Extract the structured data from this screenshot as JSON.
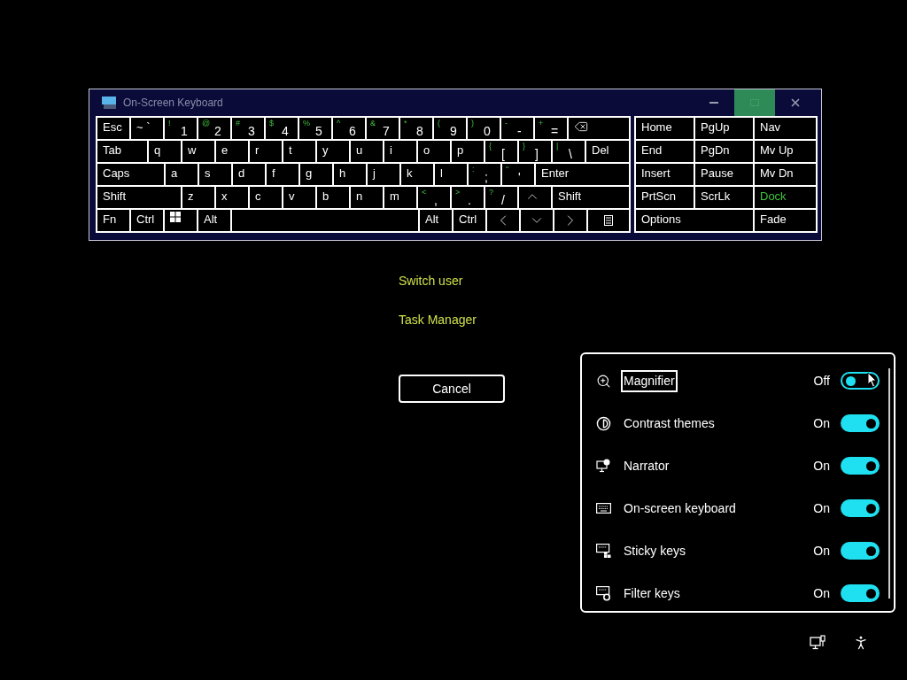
{
  "keyboard_window": {
    "title": "On-Screen Keyboard",
    "controls": [
      {
        "kind": "minimize",
        "hovered": false
      },
      {
        "kind": "maximize",
        "hovered": true
      },
      {
        "kind": "close",
        "hovered": false
      }
    ],
    "rows": [
      [
        {
          "label": "Esc"
        },
        {
          "label": "~ `"
        },
        {
          "label": "1",
          "shift": "!"
        },
        {
          "label": "2",
          "shift": "@"
        },
        {
          "label": "3",
          "shift": "#"
        },
        {
          "label": "4",
          "shift": "$"
        },
        {
          "label": "5",
          "shift": "%"
        },
        {
          "label": "6",
          "shift": "^"
        },
        {
          "label": "7",
          "shift": "&"
        },
        {
          "label": "8",
          "shift": "*"
        },
        {
          "label": "9",
          "shift": "("
        },
        {
          "label": "0",
          "shift": ")"
        },
        {
          "label": "-",
          "shift": "-"
        },
        {
          "label": "=",
          "shift": "+"
        },
        {
          "kind": "backspace"
        }
      ],
      [
        {
          "label": "Tab"
        },
        {
          "label": "q"
        },
        {
          "label": "w"
        },
        {
          "label": "e"
        },
        {
          "label": "r"
        },
        {
          "label": "t"
        },
        {
          "label": "y"
        },
        {
          "label": "u"
        },
        {
          "label": "i"
        },
        {
          "label": "o"
        },
        {
          "label": "p"
        },
        {
          "label": "[",
          "shift": "{"
        },
        {
          "label": "]",
          "shift": "}"
        },
        {
          "label": "\\",
          "shift": "|"
        },
        {
          "label": "Del"
        }
      ],
      [
        {
          "label": "Caps"
        },
        {
          "label": "a"
        },
        {
          "label": "s"
        },
        {
          "label": "d"
        },
        {
          "label": "f"
        },
        {
          "label": "g"
        },
        {
          "label": "h"
        },
        {
          "label": "j"
        },
        {
          "label": "k"
        },
        {
          "label": "l"
        },
        {
          "label": ";",
          "shift": ":"
        },
        {
          "label": "'",
          "shift": "\""
        },
        {
          "label": "Enter"
        }
      ],
      [
        {
          "label": "Shift"
        },
        {
          "label": "z"
        },
        {
          "label": "x"
        },
        {
          "label": "c"
        },
        {
          "label": "v"
        },
        {
          "label": "b"
        },
        {
          "label": "n"
        },
        {
          "label": "m"
        },
        {
          "label": ",",
          "shift": "<"
        },
        {
          "label": ".",
          "shift": ">"
        },
        {
          "label": "/",
          "shift": "?"
        },
        {
          "kind": "up"
        },
        {
          "label": "Shift"
        }
      ],
      [
        {
          "label": "Fn"
        },
        {
          "label": "Ctrl"
        },
        {
          "kind": "windows"
        },
        {
          "label": "Alt"
        },
        {
          "kind": "space"
        },
        {
          "label": "Alt"
        },
        {
          "label": "Ctrl"
        },
        {
          "kind": "left"
        },
        {
          "kind": "down"
        },
        {
          "kind": "right"
        },
        {
          "kind": "menu"
        }
      ]
    ],
    "side_rows": [
      [
        {
          "label": "Home",
          "on": false
        },
        {
          "label": "PgUp",
          "on": false
        },
        {
          "label": "Nav",
          "on": false
        }
      ],
      [
        {
          "label": "End",
          "on": false
        },
        {
          "label": "PgDn",
          "on": false
        },
        {
          "label": "Mv Up",
          "on": false
        }
      ],
      [
        {
          "label": "Insert",
          "on": false
        },
        {
          "label": "Pause",
          "on": false
        },
        {
          "label": "Mv Dn",
          "on": false
        }
      ],
      [
        {
          "label": "PrtScn",
          "on": false
        },
        {
          "label": "ScrLk",
          "on": false
        },
        {
          "label": "Dock",
          "on": true
        }
      ],
      [
        {
          "label": "Options",
          "on": false
        },
        {
          "label": "Fade",
          "on": false
        }
      ]
    ]
  },
  "menu": {
    "items": [
      "Switch user",
      "Task Manager"
    ],
    "cancel": "Cancel"
  },
  "accessibility_panel": {
    "items": [
      {
        "kind": "magnifier",
        "label": "Magnifier",
        "status": "Off",
        "on": false,
        "focused": true
      },
      {
        "kind": "contrast",
        "label": "Contrast themes",
        "status": "On",
        "on": true,
        "focused": false
      },
      {
        "kind": "narrator",
        "label": "Narrator",
        "status": "On",
        "on": true,
        "focused": false
      },
      {
        "kind": "keyboard",
        "label": "On-screen keyboard",
        "status": "On",
        "on": true,
        "focused": false
      },
      {
        "kind": "sticky",
        "label": "Sticky keys",
        "status": "On",
        "on": true,
        "focused": false
      },
      {
        "kind": "filter",
        "label": "Filter keys",
        "status": "On",
        "on": true,
        "focused": false
      }
    ]
  }
}
